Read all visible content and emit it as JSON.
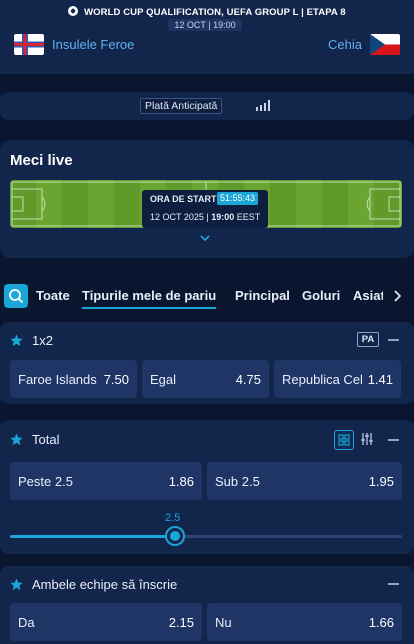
{
  "match": {
    "competition": "WORLD CUP QUALIFICATION, UEFA GROUP L  |  ETAPA  8",
    "datetime": "12 OCT | 19:00",
    "home_team": "Insulele Feroe",
    "away_team": "Cehia"
  },
  "early_payout": {
    "label": "Plată Anticipată"
  },
  "live": {
    "title": "Meci live",
    "start_label": "ORA DE START",
    "countdown": "51:55:43",
    "start_date": "12 OCT 2025 |",
    "start_time": "19:00",
    "timezone": "EEST"
  },
  "tabs": [
    {
      "label": "Toate",
      "active": false
    },
    {
      "label": "Tipurile mele de pariu",
      "active": true
    },
    {
      "label": "Principal",
      "active": false
    },
    {
      "label": "Goluri",
      "active": false
    },
    {
      "label": "Asiat",
      "active": false
    }
  ],
  "markets": {
    "m1x2": {
      "title": "1x2",
      "badge": "PA",
      "odds": [
        {
          "label": "Faroe Islands",
          "value": "7.50"
        },
        {
          "label": "Egal",
          "value": "4.75"
        },
        {
          "label": "Republica Cehă",
          "value": "1.41"
        }
      ]
    },
    "total": {
      "title": "Total",
      "odds": [
        {
          "label": "Peste 2.5",
          "value": "1.86"
        },
        {
          "label": "Sub 2.5",
          "value": "1.95"
        }
      ],
      "slider_value": "2.5",
      "slider_fraction": 0.42
    },
    "btts": {
      "title": "Ambele echipe să înscrie",
      "odds": [
        {
          "label": "Da",
          "value": "2.15"
        },
        {
          "label": "Nu",
          "value": "1.66"
        }
      ]
    }
  },
  "colors": {
    "background": "#0a1630",
    "card": "#12254a",
    "button": "#1e3566",
    "accent": "#1aa6d6",
    "team_name": "#5fb0f0"
  },
  "icons": {
    "competition": "soccer-ball-icon",
    "home_flag": "faroe-islands-flag-icon",
    "away_flag": "czech-flag-icon",
    "stats": "bar-chart-icon",
    "search": "search-icon",
    "tabs_next": "chevron-right-icon",
    "favorite": "star-icon",
    "collapse": "minus-icon",
    "grid": "grid-icon",
    "filter": "sliders-icon",
    "expand": "chevron-down-icon"
  }
}
